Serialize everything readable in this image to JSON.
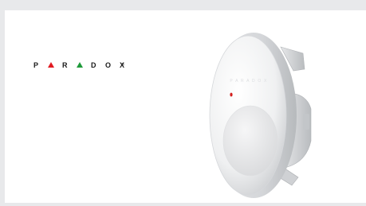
{
  "logo": {
    "letters": [
      "P",
      "R",
      "D",
      "O",
      "X"
    ],
    "mark": "®",
    "triangle_colors": [
      "#e11b22",
      "#1f9a3a"
    ],
    "text_color": "#1a1a1a"
  },
  "device": {
    "embossed_text": "P A R A D O X",
    "led_color": "#d3201f",
    "body_color": "#f2f3f4"
  }
}
